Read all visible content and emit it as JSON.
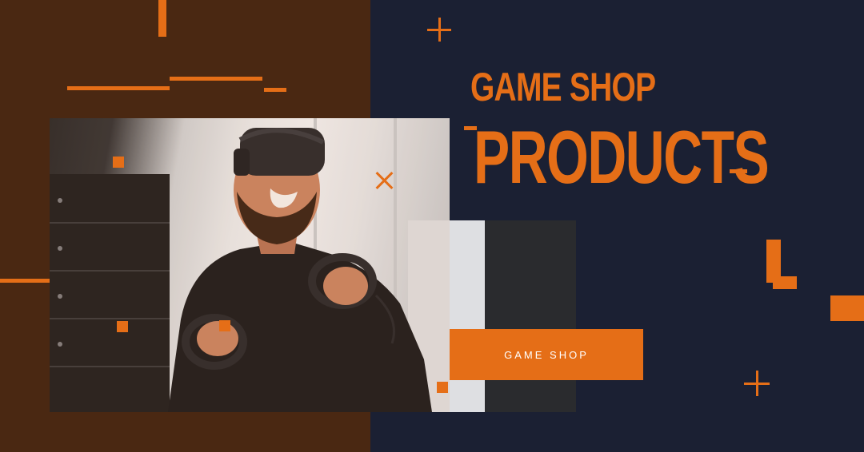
{
  "banner": {
    "title_line1": "GAME SHOP",
    "title_line2": "PRODUCTS",
    "button_label": "GAME SHOP"
  },
  "colors": {
    "accent": "#e56e17",
    "left_panel": "#4a2812",
    "right_panel": "#1b2033",
    "button_text": "#ffffff"
  },
  "image": {
    "subject": "man-wearing-vr-headset-holding-controllers"
  },
  "icons": [
    "plus-icon",
    "close-icon"
  ]
}
